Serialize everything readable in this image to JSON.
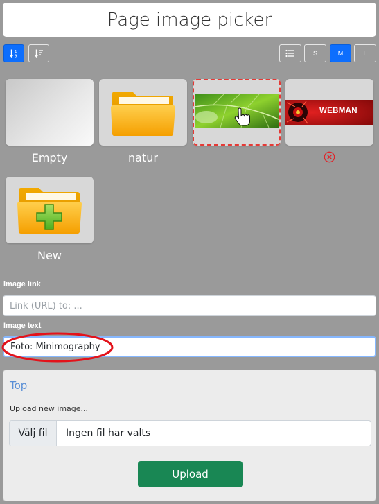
{
  "header": {
    "title": "Page image picker"
  },
  "toolbar": {
    "sort_asc_icon": "sort-alpha-ascending-icon",
    "sort_desc_icon": "sort-descending-icon",
    "list_view_icon": "list-icon",
    "size_s": "S",
    "size_m": "M",
    "size_l": "L",
    "selected_size": "M"
  },
  "gallery": {
    "items": [
      {
        "label": "Empty",
        "kind": "empty"
      },
      {
        "label": "natur",
        "kind": "folder"
      },
      {
        "label": "",
        "kind": "image-leaf",
        "selected": true
      },
      {
        "label": "",
        "kind": "image-webman",
        "banner_text": "WEBMAN",
        "delete_icon": "remove-circle-icon"
      },
      {
        "label": "New",
        "kind": "new-folder"
      }
    ]
  },
  "form": {
    "image_link_label": "Image link",
    "image_link_placeholder": "Link (URL) to: ...",
    "image_link_value": "",
    "image_text_label": "Image text",
    "image_text_value": "Foto: Minimography"
  },
  "upload": {
    "top_link": "Top",
    "caption": "Upload new image...",
    "choose_file_label": "Välj fil",
    "no_file_text": "Ingen fil har valts",
    "upload_button": "Upload"
  },
  "colors": {
    "accent": "#0d6efd",
    "upload_green": "#198754",
    "selection_red": "#e53935",
    "link_blue": "#5a8fd6"
  }
}
